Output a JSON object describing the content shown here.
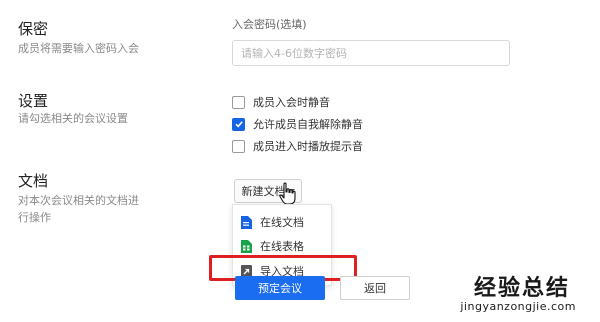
{
  "password": {
    "title": "保密",
    "desc": "成员将需要输入密码入会",
    "field_label": "入会密码(选填)",
    "placeholder": "请输入4-6位数字密码"
  },
  "settings": {
    "title": "设置",
    "desc": "请勾选相关的会议设置",
    "options": [
      {
        "label": "成员入会时静音",
        "checked": false
      },
      {
        "label": "允许成员自我解除静音",
        "checked": true
      },
      {
        "label": "成员进入时播放提示音",
        "checked": false
      }
    ]
  },
  "docs": {
    "title": "文档",
    "desc_lines": [
      "对本次会议相关的文档进",
      "行操作"
    ],
    "dropdown_label": "新建文档",
    "menu": [
      {
        "label": "在线文档",
        "icon": "online-doc-icon",
        "color": "#1664e6"
      },
      {
        "label": "在线表格",
        "icon": "online-sheet-icon",
        "color": "#17a34a"
      },
      {
        "label": "导入文档",
        "icon": "import-doc-icon",
        "color": "#555555"
      }
    ]
  },
  "actions": {
    "schedule_label": "预定会议",
    "back_label": "返回"
  },
  "watermark": {
    "text": "经验总结",
    "url": "jingyanzongjie.com"
  },
  "colors": {
    "accent": "#1a6cf0",
    "highlight": "#e02020"
  }
}
